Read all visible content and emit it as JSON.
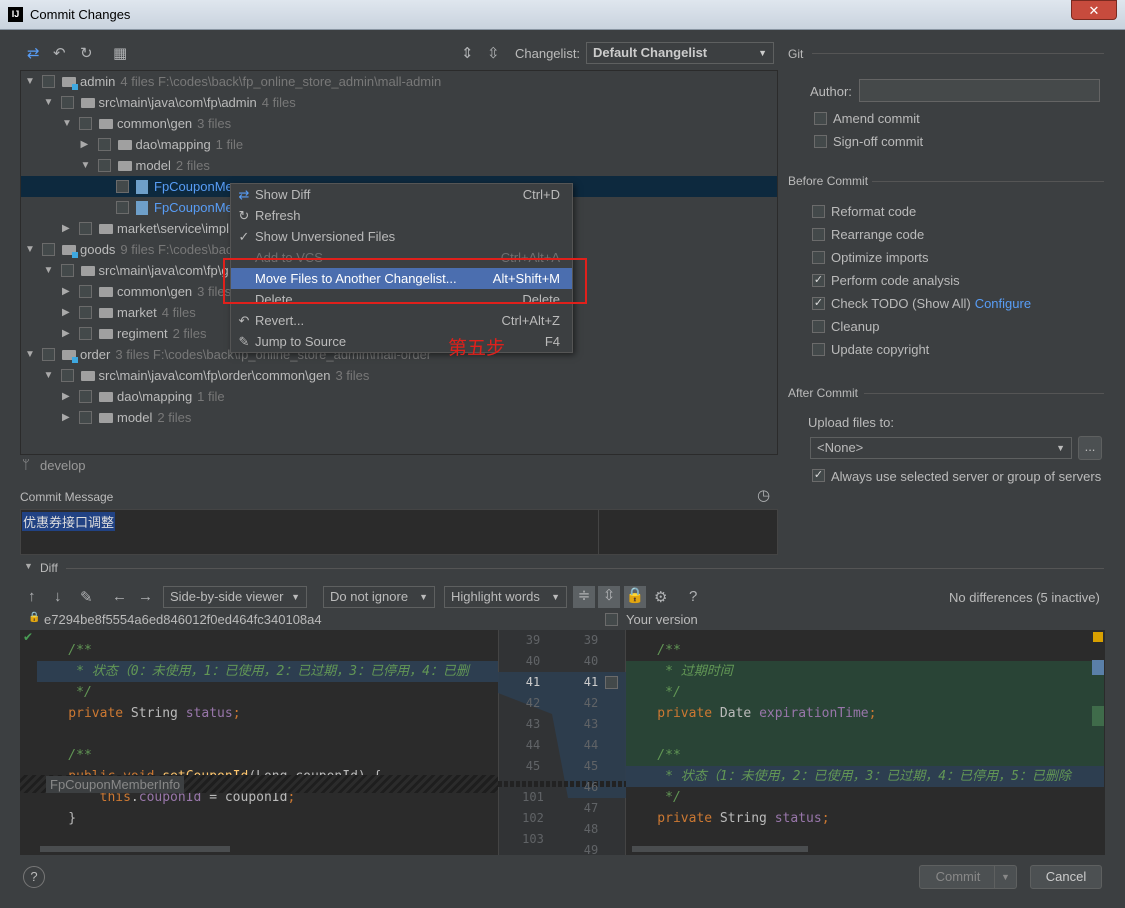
{
  "window": {
    "title": "Commit Changes",
    "close": "✕"
  },
  "toolbar": {
    "changelist_label": "Changelist:",
    "changelist_value": "Default Changelist"
  },
  "tree": [
    {
      "level": 0,
      "arrow": "▼",
      "type": "module",
      "name": "admin",
      "meta": "4 files  F:\\codes\\back\\fp_online_store_admin\\mall-admin"
    },
    {
      "level": 1,
      "arrow": "▼",
      "type": "folder",
      "name": "src\\main\\java\\com\\fp\\admin",
      "meta": "4 files"
    },
    {
      "level": 2,
      "arrow": "▼",
      "type": "folder",
      "name": "common\\gen",
      "meta": "3 files"
    },
    {
      "level": 3,
      "arrow": "▶",
      "type": "folder",
      "name": "dao\\mapping",
      "meta": "1 file"
    },
    {
      "level": 3,
      "arrow": "▼",
      "type": "folder",
      "name": "model",
      "meta": "2 files"
    },
    {
      "level": 4,
      "arrow": "",
      "type": "java",
      "name": "FpCouponMe",
      "meta": "",
      "selected": true
    },
    {
      "level": 4,
      "arrow": "",
      "type": "java",
      "name": "FpCouponMe",
      "meta": ""
    },
    {
      "level": 2,
      "arrow": "▶",
      "type": "folder",
      "name": "market\\service\\impl",
      "meta": ""
    },
    {
      "level": 0,
      "arrow": "▼",
      "type": "module",
      "name": "goods",
      "meta": "9 files  F:\\codes\\back\\fp"
    },
    {
      "level": 1,
      "arrow": "▼",
      "type": "folder",
      "name": "src\\main\\java\\com\\fp\\g",
      "meta": ""
    },
    {
      "level": 2,
      "arrow": "▶",
      "type": "folder",
      "name": "common\\gen",
      "meta": "3 files"
    },
    {
      "level": 2,
      "arrow": "▶",
      "type": "folder",
      "name": "market",
      "meta": "4 files"
    },
    {
      "level": 2,
      "arrow": "▶",
      "type": "folder",
      "name": "regiment",
      "meta": "2 files"
    },
    {
      "level": 0,
      "arrow": "▼",
      "type": "module",
      "name": "order",
      "meta": "3 files  F:\\codes\\back\\fp_online_store_admin\\mall-order"
    },
    {
      "level": 1,
      "arrow": "▼",
      "type": "folder",
      "name": "src\\main\\java\\com\\fp\\order\\common\\gen",
      "meta": "3 files"
    },
    {
      "level": 2,
      "arrow": "▶",
      "type": "folder",
      "name": "dao\\mapping",
      "meta": "1 file"
    },
    {
      "level": 2,
      "arrow": "▶",
      "type": "folder",
      "name": "model",
      "meta": "2 files"
    }
  ],
  "context_menu": [
    {
      "icon": "show-diff",
      "glyph": "⇄",
      "label": "Show Diff",
      "shortcut": "Ctrl+D"
    },
    {
      "icon": "refresh",
      "glyph": "↻",
      "label": "Refresh",
      "shortcut": ""
    },
    {
      "icon": "check",
      "glyph": "✓",
      "label": "Show Unversioned Files",
      "shortcut": ""
    },
    {
      "icon": "",
      "glyph": "",
      "label": "Add to VCS",
      "shortcut": "Ctrl+Alt+A",
      "disabled": true
    },
    {
      "icon": "",
      "glyph": "",
      "label": "Move Files to Another Changelist...",
      "shortcut": "Alt+Shift+M",
      "highlighted": true
    },
    {
      "icon": "",
      "glyph": "",
      "label": "Delete",
      "shortcut": "Delete"
    },
    {
      "icon": "revert",
      "glyph": "↶",
      "label": "Revert...",
      "shortcut": "Ctrl+Alt+Z"
    },
    {
      "icon": "pencil",
      "glyph": "✎",
      "label": "Jump to Source",
      "shortcut": "F4"
    }
  ],
  "annotation": {
    "text": "第五步",
    "color": "#e0201b"
  },
  "branch": "develop",
  "commit_message": {
    "label": "Commit Message",
    "value": "优惠券接口调整"
  },
  "right": {
    "git_title": "Git",
    "author_label": "Author:",
    "author_value": "",
    "git_options": [
      {
        "label": "Amend commit",
        "checked": false
      },
      {
        "label": "Sign-off commit",
        "checked": false
      }
    ],
    "before_title": "Before Commit",
    "before_options": [
      {
        "label": "Reformat code",
        "checked": false
      },
      {
        "label": "Rearrange code",
        "checked": false
      },
      {
        "label": "Optimize imports",
        "checked": false
      },
      {
        "label": "Perform code analysis",
        "checked": true
      },
      {
        "label": "Check TODO (Show All)",
        "checked": true,
        "link": "Configure"
      },
      {
        "label": "Cleanup",
        "checked": false
      },
      {
        "label": "Update copyright",
        "checked": false
      }
    ],
    "after_title": "After Commit",
    "upload_label": "Upload files to:",
    "upload_value": "<None>",
    "browse": "...",
    "always_label": "Always use selected server or group of servers",
    "always_checked": true
  },
  "diff": {
    "title": "Diff",
    "viewer": "Side-by-side viewer",
    "ignore": "Do not ignore",
    "highlight": "Highlight words",
    "help": "?",
    "status": "No differences (5 inactive)",
    "revision": "e7294be8f5554a6ed846012f0ed464fc340108a4",
    "your_version": "Your version",
    "breadcrumb": "FpCouponMemberInfo",
    "left_lines": [
      "39",
      "40",
      "41",
      "42",
      "43",
      "44",
      "45",
      "101",
      "102",
      "103"
    ],
    "right_lines": [
      "39",
      "40",
      "41",
      "42",
      "43",
      "44",
      "45",
      "46",
      "47",
      "48",
      "49"
    ],
    "left_code": [
      {
        "parts": [
          {
            "c": "cm",
            "t": ""
          }
        ]
      },
      {
        "parts": [
          {
            "c": "cm",
            "t": "    /**"
          }
        ]
      },
      {
        "parts": [
          {
            "c": "cm",
            "t": "     * 状态（0：未使用，1：已使用，2：已过期，3：已停用，4：已删"
          }
        ],
        "hl": true
      },
      {
        "parts": [
          {
            "c": "cm",
            "t": "     */"
          }
        ]
      },
      {
        "parts": [
          {
            "c": "kw",
            "t": "    private "
          },
          {
            "c": "",
            "t": "String "
          },
          {
            "c": "fld",
            "t": "status"
          },
          {
            "c": "kw",
            "t": ";"
          }
        ]
      },
      {
        "parts": [
          {
            "c": "",
            "t": ""
          }
        ]
      },
      {
        "parts": [
          {
            "c": "cm",
            "t": "    /**"
          }
        ]
      },
      {
        "parts": [
          {
            "c": "",
            "t": ""
          }
        ]
      },
      {
        "parts": [
          {
            "c": "kw",
            "t": "    public void "
          },
          {
            "c": "mth",
            "t": "setCouponId"
          },
          {
            "c": "",
            "t": "(Long couponId) {"
          }
        ]
      },
      {
        "parts": [
          {
            "c": "kw",
            "t": "        this"
          },
          {
            "c": "",
            "t": "."
          },
          {
            "c": "fld",
            "t": "couponId"
          },
          {
            "c": "",
            "t": " = couponId"
          },
          {
            "c": "kw",
            "t": ";"
          }
        ]
      },
      {
        "parts": [
          {
            "c": "",
            "t": "    }"
          }
        ]
      }
    ],
    "right_code": [
      {
        "parts": [
          {
            "c": "",
            "t": ""
          }
        ]
      },
      {
        "parts": [
          {
            "c": "cm",
            "t": "    /**"
          }
        ]
      },
      {
        "parts": [
          {
            "c": "cm",
            "t": "     * 过期时间"
          }
        ],
        "add": true
      },
      {
        "parts": [
          {
            "c": "cm",
            "t": "     */"
          }
        ],
        "add": true
      },
      {
        "parts": [
          {
            "c": "kw",
            "t": "    private "
          },
          {
            "c": "",
            "t": "Date "
          },
          {
            "c": "fld",
            "t": "expirationTime"
          },
          {
            "c": "kw",
            "t": ";"
          }
        ],
        "add": true
      },
      {
        "parts": [
          {
            "c": "",
            "t": ""
          }
        ],
        "add": true
      },
      {
        "parts": [
          {
            "c": "cm",
            "t": "    /**"
          }
        ],
        "add": true
      },
      {
        "parts": [
          {
            "c": "cm",
            "t": "     * 状态（1：未使用，2：已使用，3：已过期，4：已停用，5：已删除"
          }
        ],
        "hl": true
      },
      {
        "parts": [
          {
            "c": "cm",
            "t": "     */"
          }
        ]
      },
      {
        "parts": [
          {
            "c": "kw",
            "t": "    private "
          },
          {
            "c": "",
            "t": "String "
          },
          {
            "c": "fld",
            "t": "status"
          },
          {
            "c": "kw",
            "t": ";"
          }
        ]
      }
    ]
  },
  "footer": {
    "help": "?",
    "commit": "Commit",
    "cancel": "Cancel"
  }
}
